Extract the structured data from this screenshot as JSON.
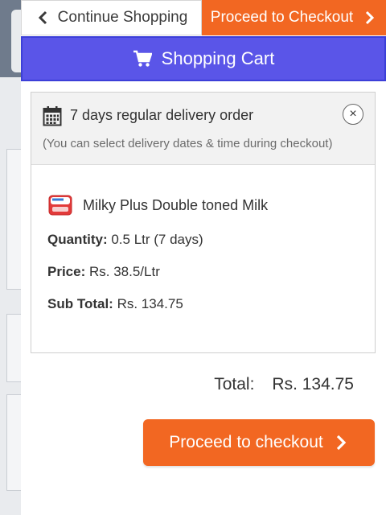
{
  "top_bar": {
    "continue_label": "Continue Shopping",
    "checkout_label": "Proceed to Checkout"
  },
  "cart_header": {
    "title": "Shopping Cart",
    "icon": "cart-icon"
  },
  "order": {
    "title": "7 days regular delivery order",
    "subtitle": "(You can select delivery dates & time during checkout)",
    "close_symbol": "×",
    "item": {
      "name": "Milky Plus Double toned Milk",
      "quantity_label": "Quantity:",
      "quantity_value": "0.5 Ltr (7 days)",
      "price_label": "Price:",
      "price_value": "Rs. 38.5/Ltr",
      "subtotal_label": "Sub Total:",
      "subtotal_value": "Rs. 134.75"
    }
  },
  "total": {
    "label": "Total:",
    "value": "Rs. 134.75"
  },
  "checkout_button": {
    "label": "Proceed to checkout"
  },
  "colors": {
    "accent_orange": "#f26722",
    "header_blue": "#5a55e8"
  }
}
